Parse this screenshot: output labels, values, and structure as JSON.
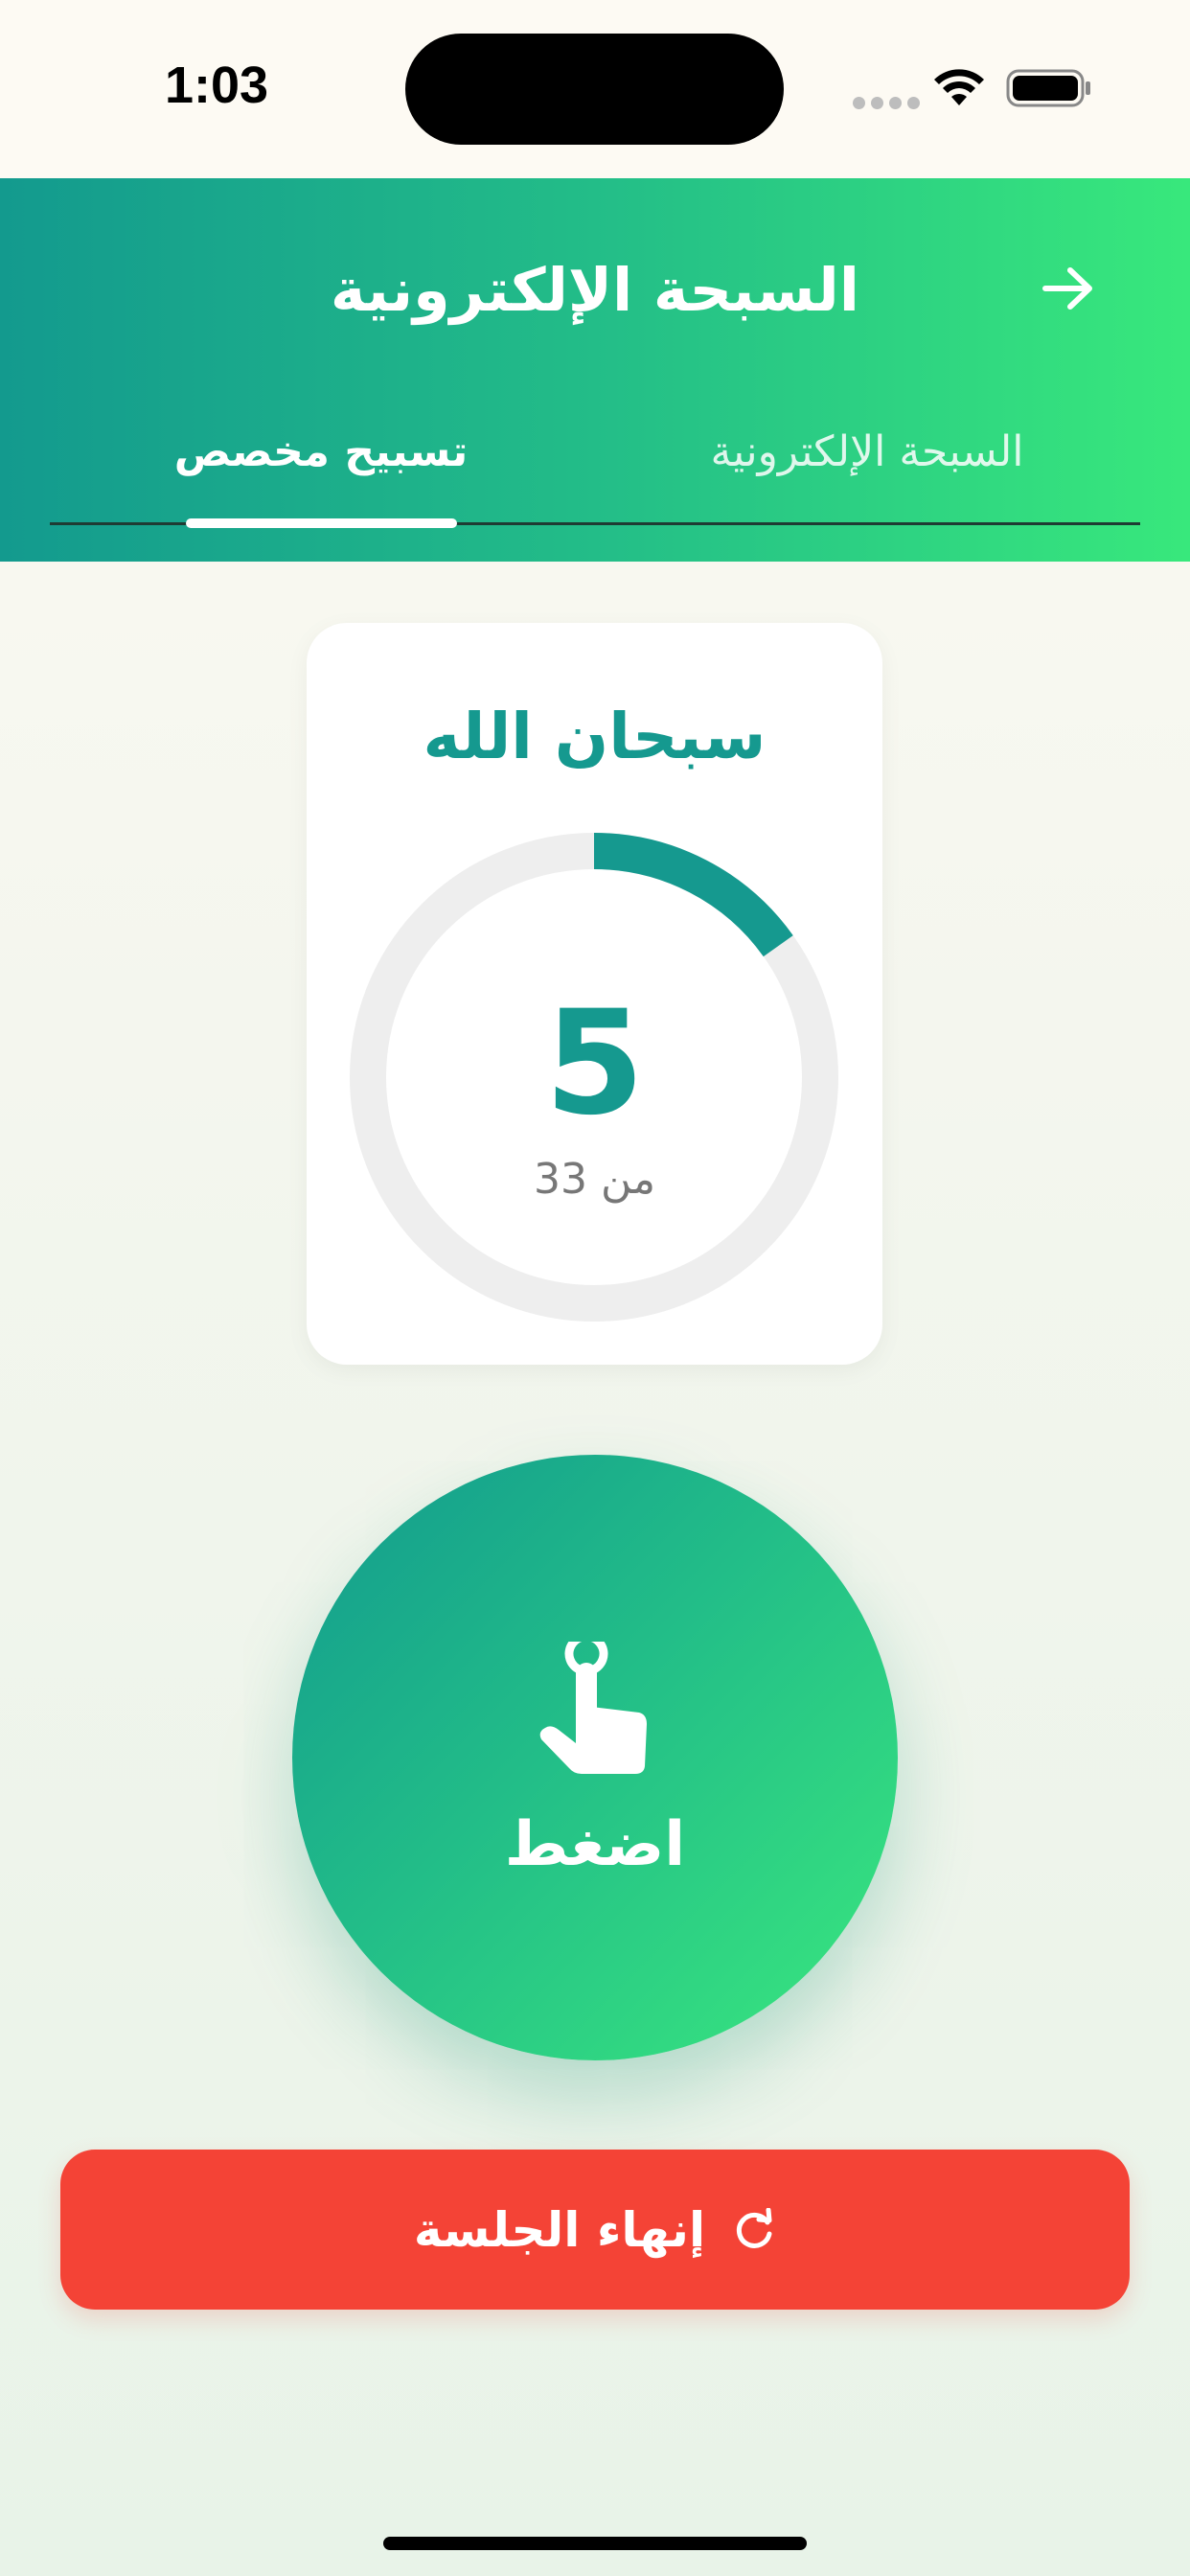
{
  "status_bar": {
    "time": "1:03",
    "wifi_icon": "wifi-icon",
    "battery_icon": "battery-icon"
  },
  "header": {
    "title": "السبحة الإلكترونية",
    "back_icon": "arrow-right-icon",
    "tabs": [
      {
        "label": "تسبيح مخصص",
        "active": true
      },
      {
        "label": "السبحة الإلكترونية",
        "active": false
      }
    ]
  },
  "counter": {
    "dhikr": "سبحان الله",
    "count": 5,
    "count_display": "5",
    "target_label": "من 33",
    "target": 33
  },
  "tap_button": {
    "label": "اضغط",
    "icon": "hand-pointer-icon"
  },
  "end_session": {
    "label": "إنهاء الجلسة",
    "icon": "refresh-icon"
  },
  "colors": {
    "accent": "#15998f",
    "gradient_start": "#139a8e",
    "gradient_end": "#38e87c",
    "danger": "#f44336",
    "ring_track": "#eeeeee"
  }
}
